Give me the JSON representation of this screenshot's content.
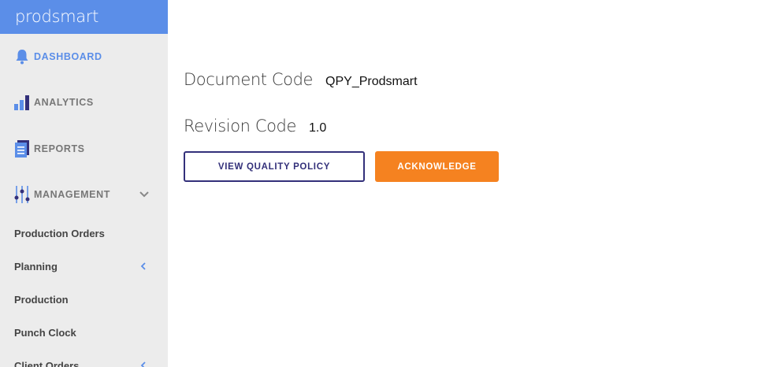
{
  "brand": {
    "name": "prodsmart"
  },
  "sidebar": {
    "nav": [
      {
        "label": "DASHBOARD",
        "icon": "bell-icon"
      },
      {
        "label": "ANALYTICS",
        "icon": "bar-chart-icon"
      },
      {
        "label": "REPORTS",
        "icon": "document-icon"
      },
      {
        "label": "MANAGEMENT",
        "icon": "sliders-icon"
      }
    ],
    "sub_items": [
      {
        "label": "Production Orders"
      },
      {
        "label": "Planning"
      },
      {
        "label": "Production"
      },
      {
        "label": "Punch Clock"
      },
      {
        "label": "Client Orders"
      }
    ]
  },
  "main": {
    "document_code_label": "Document Code",
    "document_code_value": "QPY_Prodsmart",
    "revision_code_label": "Revision Code",
    "revision_code_value": "1.0",
    "view_policy_button": "VIEW QUALITY POLICY",
    "acknowledge_button": "ACKNOWLEDGE"
  },
  "colors": {
    "brand": "#5b8ee8",
    "sidebar_bg": "#ececec",
    "accent_orange": "#f58220",
    "outline_navy": "#33307a"
  }
}
